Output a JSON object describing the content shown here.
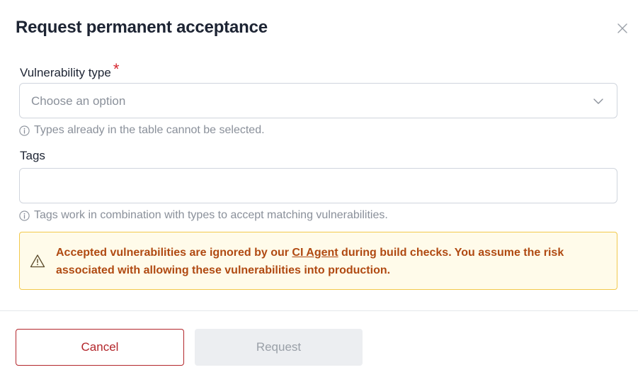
{
  "dialog": {
    "title": "Request permanent acceptance",
    "close_icon": "close-icon"
  },
  "vulnerability_type": {
    "label": "Vulnerability type",
    "required_marker": "*",
    "placeholder": "Choose an option",
    "hint": "Types already in the table cannot be selected."
  },
  "tags": {
    "label": "Tags",
    "value": "",
    "hint": "Tags work in combination with types to accept matching vulnerabilities."
  },
  "warning": {
    "text_before": "Accepted vulnerabilities are ignored by our ",
    "link_text": "CI Agent",
    "text_after": " during build checks. You assume the risk associated with allowing these vulnerabilities into production.",
    "icon": "warning-triangle-icon"
  },
  "footer": {
    "cancel_label": "Cancel",
    "request_label": "Request"
  },
  "colors": {
    "danger": "#b3262b",
    "warning_bg": "#fffbea",
    "warning_border": "#f2c94c",
    "warning_text": "#b04a12",
    "disabled_bg": "#eceef1"
  }
}
